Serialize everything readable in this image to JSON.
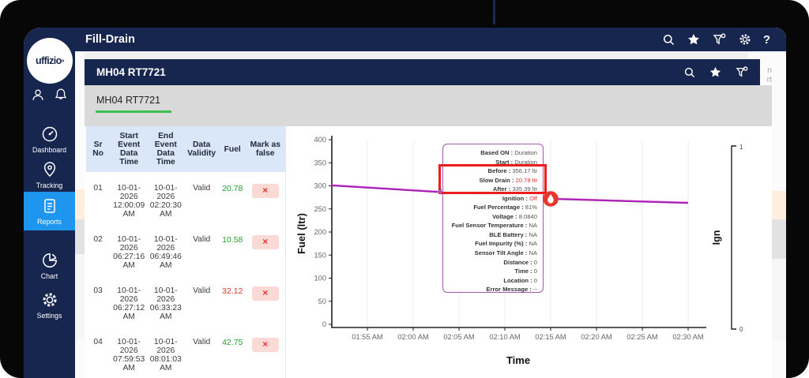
{
  "brand": {
    "logo_text": "uffizio",
    "logo_mark": "»"
  },
  "sidebar": {
    "items": [
      {
        "label": "Dashboard",
        "icon": "gauge-icon",
        "active": false
      },
      {
        "label": "Tracking",
        "icon": "location-pin-icon",
        "active": false
      },
      {
        "label": "Reports",
        "icon": "report-doc-icon",
        "active": true
      },
      {
        "label": "Chart",
        "icon": "pie-chart-icon",
        "active": false
      },
      {
        "label": "Settings",
        "icon": "gear-icon",
        "active": false
      }
    ],
    "active_color": "#1e96f0"
  },
  "header": {
    "title": "Fill-Drain",
    "icons": [
      "search-icon",
      "star-icon",
      "filter-gear-icon",
      "gear-icon",
      "help-icon"
    ],
    "help_glyph": "?"
  },
  "vehicle_bar": {
    "title": "MH04 RT7721",
    "icons": [
      "search-icon",
      "star-icon",
      "filter-gear-icon"
    ]
  },
  "tabs": [
    {
      "label": "MH04 RT7721",
      "active": true,
      "underline_color": "#3cbf4e"
    }
  ],
  "background_page": {
    "clipped_text_line1": "n",
    "clipped_text_line2": "rt",
    "strip_peach": "#fdeedd",
    "strip_gray": "#e2e2e2",
    "strip_light": "#f6f6f6"
  },
  "table": {
    "columns": [
      "Sr No",
      "Start Event Data Time",
      "End Event Data Time",
      "Data Validity",
      "Fuel",
      "Mark as false"
    ],
    "action_glyph": "×",
    "rows": [
      {
        "sr": "01",
        "start": "10-01-2026 12:00:09 AM",
        "end": "10-01-2026 02:20:30 AM",
        "validity": "Valid",
        "fuel": "20.78",
        "fuel_color": "#26a32f"
      },
      {
        "sr": "02",
        "start": "10-01-2026 06:27:16 AM",
        "end": "10-01-2026 06:49:46 AM",
        "validity": "Valid",
        "fuel": "10.58",
        "fuel_color": "#26a32f"
      },
      {
        "sr": "03",
        "start": "10-01-2026 06:27:12 AM",
        "end": "10-01-2026 06:33:23 AM",
        "validity": "Valid",
        "fuel": "32.12",
        "fuel_color": "#e8352e"
      },
      {
        "sr": "04",
        "start": "10-01-2026 07:59:53 AM",
        "end": "10-01-2026 08:01:03 AM",
        "validity": "Valid",
        "fuel": "42.75",
        "fuel_color": "#26a32f"
      }
    ]
  },
  "chart_data": {
    "type": "line",
    "xlabel": "Time",
    "ylabel": "Fuel (ltr)",
    "y2label": "Ign",
    "x_ticks": [
      "01:55 AM",
      "02:00 AM",
      "02:05 AM",
      "02:10 AM",
      "02:15 AM",
      "02:20 AM",
      "02:25 AM",
      "02:30 AM"
    ],
    "y_ticks": [
      0,
      50,
      100,
      150,
      200,
      250,
      300,
      350,
      400
    ],
    "ylim": [
      0,
      400
    ],
    "y2_ticks": [
      "0",
      "1"
    ],
    "grid": "vertical-only",
    "series": [
      {
        "name": "Fuel",
        "color": "#a21caf",
        "points": [
          {
            "t": "01:51 AM",
            "v": 301
          },
          {
            "t": "02:15 AM",
            "v": 272
          },
          {
            "t": "02:30 AM",
            "v": 263
          }
        ]
      }
    ],
    "event_marker": {
      "t": "02:15 AM",
      "v": 272,
      "color": "#e8352e",
      "icon": "fuel-drop-icon"
    }
  },
  "tooltip": {
    "rows": [
      {
        "label": "Based ON",
        "value": "Duration"
      },
      {
        "label": "Start",
        "value": "Duration"
      },
      {
        "label": "Before",
        "value": "356.17 ltr",
        "highlighted": true
      },
      {
        "label": "Slow Drain",
        "value": "20.78 ltr",
        "red": true,
        "highlighted": true
      },
      {
        "label": "After",
        "value": "335.39 ltr",
        "highlighted": true
      },
      {
        "label": "Ignition",
        "value": "Off",
        "red": true
      },
      {
        "label": "Fuel Percentage",
        "value": "81%"
      },
      {
        "label": "Voltage",
        "value": "8.0840"
      },
      {
        "label": "Fuel Sensor Temperature",
        "value": "NA"
      },
      {
        "label": "BLE Battery",
        "value": "NA"
      },
      {
        "label": "Fuel Impurity (%)",
        "value": "NA"
      },
      {
        "label": "Sensor Tilt Angle",
        "value": "NA"
      },
      {
        "label": "Distance",
        "value": "0"
      },
      {
        "label": "Time",
        "value": "0"
      },
      {
        "label": "Location",
        "value": "0"
      },
      {
        "label": "Error Message",
        "value": "--"
      }
    ],
    "border_color": "#a05ab0",
    "highlight_box_color": "#ec1d1d"
  }
}
